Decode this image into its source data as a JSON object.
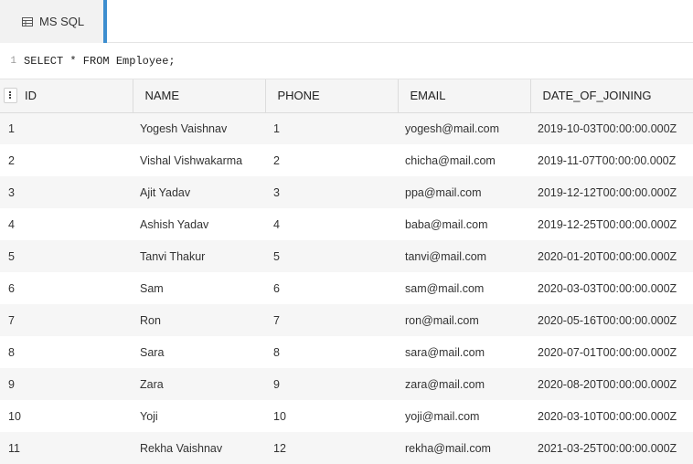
{
  "tab": {
    "label": "MS SQL",
    "icon": "database-icon"
  },
  "editor": {
    "line_number": "1",
    "query": "SELECT * FROM Employee;"
  },
  "grid": {
    "columns": [
      "ID",
      "NAME",
      "PHONE",
      "EMAIL",
      "DATE_OF_JOINING"
    ],
    "rows": [
      [
        "1",
        "Yogesh Vaishnav",
        "1",
        "yogesh@mail.com",
        "2019-10-03T00:00:00.000Z"
      ],
      [
        "2",
        "Vishal Vishwakarma",
        "2",
        "chicha@mail.com",
        "2019-11-07T00:00:00.000Z"
      ],
      [
        "3",
        "Ajit Yadav",
        "3",
        "ppa@mail.com",
        "2019-12-12T00:00:00.000Z"
      ],
      [
        "4",
        "Ashish Yadav",
        "4",
        "baba@mail.com",
        "2019-12-25T00:00:00.000Z"
      ],
      [
        "5",
        "Tanvi Thakur",
        "5",
        "tanvi@mail.com",
        "2020-01-20T00:00:00.000Z"
      ],
      [
        "6",
        "Sam",
        "6",
        "sam@mail.com",
        "2020-03-03T00:00:00.000Z"
      ],
      [
        "7",
        "Ron",
        "7",
        "ron@mail.com",
        "2020-05-16T00:00:00.000Z"
      ],
      [
        "8",
        "Sara",
        "8",
        "sara@mail.com",
        "2020-07-01T00:00:00.000Z"
      ],
      [
        "9",
        "Zara",
        "9",
        "zara@mail.com",
        "2020-08-20T00:00:00.000Z"
      ],
      [
        "10",
        "Yoji",
        "10",
        "yoji@mail.com",
        "2020-03-10T00:00:00.000Z"
      ],
      [
        "11",
        "Rekha Vaishnav",
        "12",
        "rekha@mail.com",
        "2021-03-25T00:00:00.000Z"
      ]
    ]
  },
  "colors": {
    "accent": "#3d8ecf",
    "header_bg": "#f5f5f5",
    "row_alt": "#f6f6f6"
  }
}
